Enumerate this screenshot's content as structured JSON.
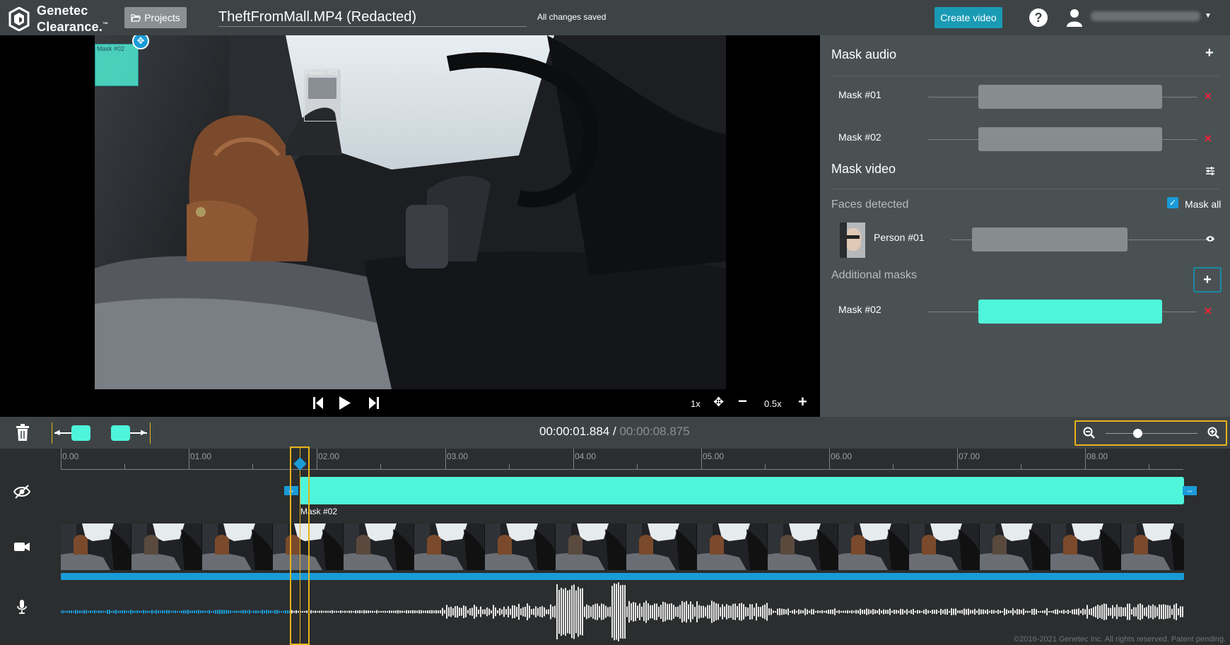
{
  "header": {
    "logo_line1": "Genetec",
    "logo_line2": "Clearance.",
    "logo_tm": "™",
    "projects_label": "Projects",
    "file_title": "TheftFromMall.MP4 (Redacted)",
    "saved_status": "All changes saved",
    "create_label": "Create video",
    "help_label": "?"
  },
  "video": {
    "mask_overlay_label": "Mask #02",
    "person_overlay_label": "Person #01",
    "speed_label": "1x",
    "zoom_label": "0.5x"
  },
  "panel": {
    "mask_audio_title": "Mask audio",
    "audio_masks": [
      {
        "label": "Mask #01"
      },
      {
        "label": "Mask #02"
      }
    ],
    "mask_video_title": "Mask video",
    "faces_detected": "Faces detected",
    "mask_all": "Mask all",
    "person_label": "Person #01",
    "additional_masks": "Additional masks",
    "additional_mask_label": "Mask #02"
  },
  "timeline": {
    "current_time": "00:00:01.884",
    "separator": " / ",
    "total_time": "00:00:08.875",
    "ticks": [
      "0.00",
      "01.00",
      "02.00",
      "03.00",
      "04.00",
      "05.00",
      "06.00",
      "07.00",
      "08.00"
    ],
    "mask_bar_label": "Mask #02",
    "copyright": "©2016-2021 Genetec Inc. All rights reserved. Patent pending."
  },
  "colors": {
    "accent": "#1a9bd8",
    "mask": "#4ff5db",
    "highlight": "#e8b41b",
    "remove": "#ff1f35"
  },
  "icons": {
    "delete": "trash-icon",
    "play": "play-icon",
    "prev": "skip-back-icon",
    "next": "skip-forward-icon"
  }
}
